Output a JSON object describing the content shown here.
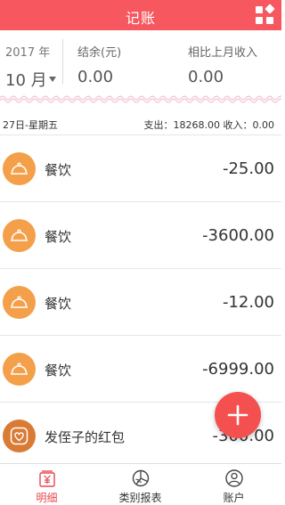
{
  "header": {
    "title": "记账",
    "grid_icon": "grid-menu-icon"
  },
  "summary": {
    "year": "2017 年",
    "month": "10 月",
    "balance_label": "结余(元)",
    "balance_value": "0.00",
    "compare_label": "相比上月收入",
    "compare_value": "0.00"
  },
  "day": {
    "date": "27日-星期五",
    "stats": "支出：18268.00 收入：0.00"
  },
  "transactions": [
    {
      "category": "餐饮",
      "amount": "-25.00",
      "icon": "dining-cloche-icon",
      "color": "#f4a04a"
    },
    {
      "category": "餐饮",
      "amount": "-3600.00",
      "icon": "dining-cloche-icon",
      "color": "#f4a04a"
    },
    {
      "category": "餐饮",
      "amount": "-12.00",
      "icon": "dining-cloche-icon",
      "color": "#f4a04a"
    },
    {
      "category": "餐饮",
      "amount": "-6999.00",
      "icon": "dining-cloche-icon",
      "color": "#f4a04a"
    },
    {
      "category": "发侄子的红包",
      "amount": "-300.00",
      "icon": "heart-icon",
      "color": "#d97a35"
    }
  ],
  "tabs": [
    {
      "label": "明细",
      "icon": "ledger-icon",
      "active": true
    },
    {
      "label": "类别报表",
      "icon": "pie-chart-icon",
      "active": false
    },
    {
      "label": "账户",
      "icon": "user-icon",
      "active": false
    }
  ],
  "colors": {
    "accent": "#f7575f",
    "fab": "#f4504f",
    "dining": "#f4a04a",
    "gift": "#d97a35"
  }
}
